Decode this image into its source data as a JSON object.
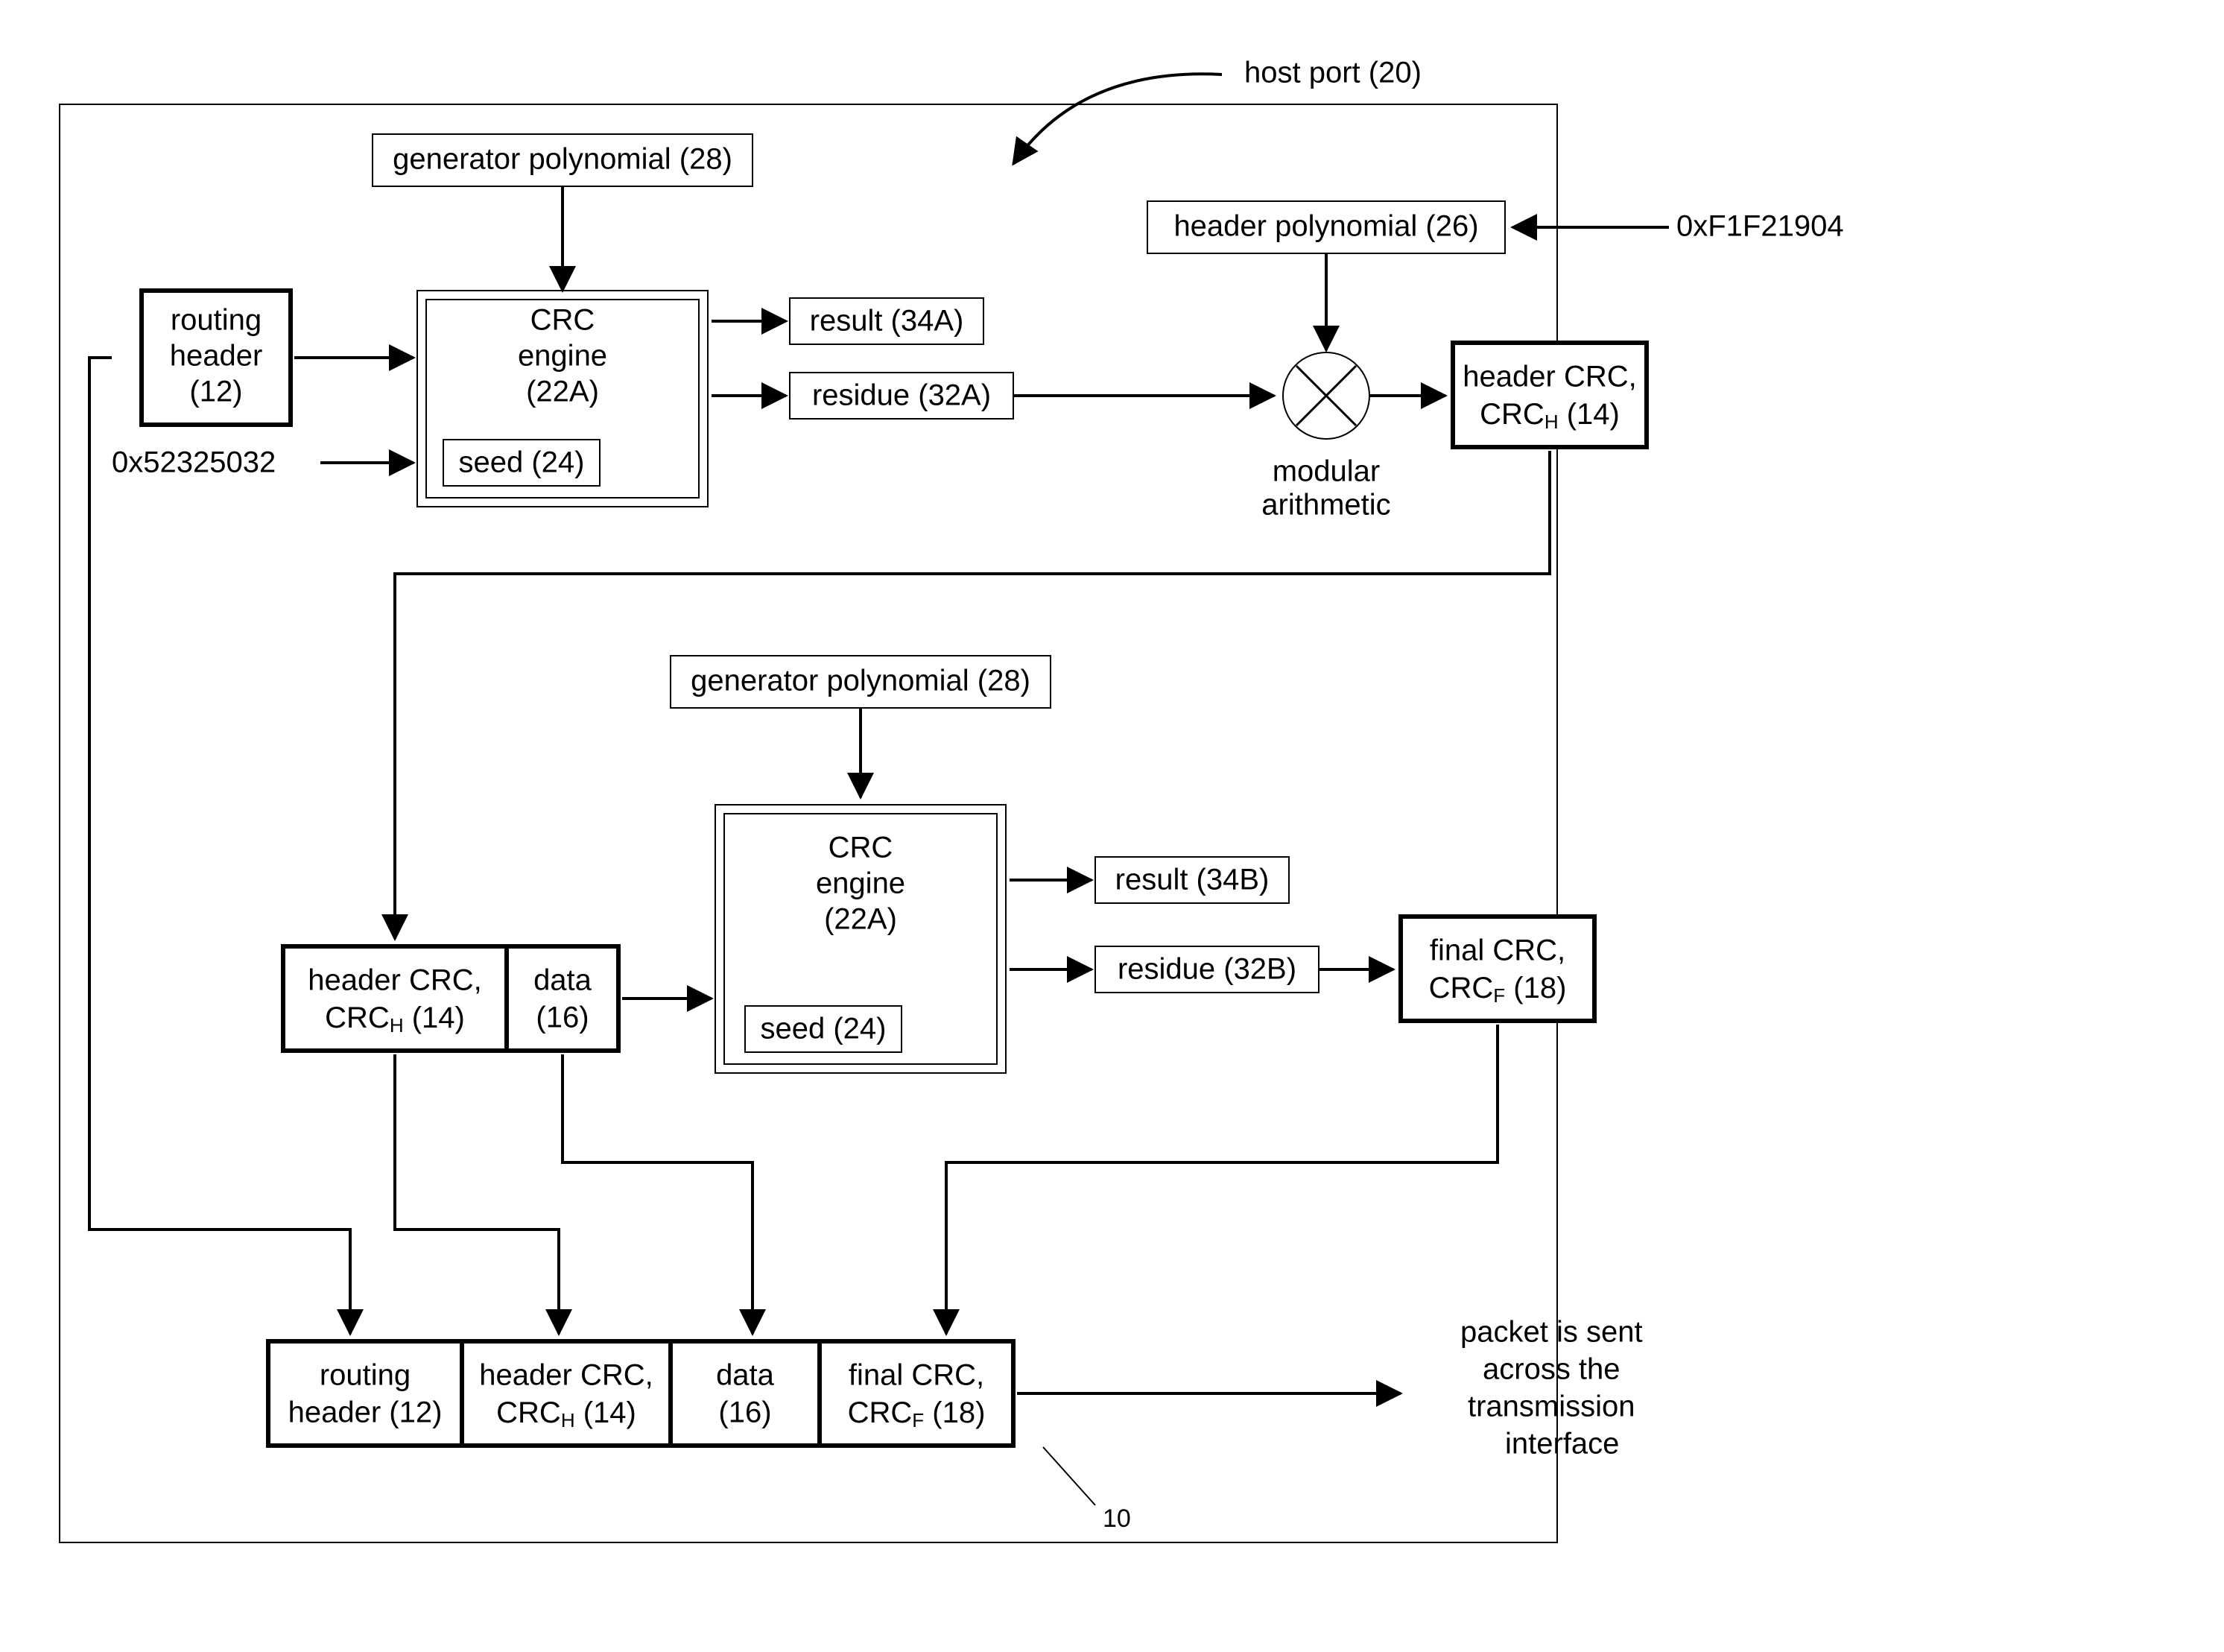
{
  "labels": {
    "host_port": "host port (20)",
    "gen_poly_1": "generator polynomial (28)",
    "gen_poly_2": "generator polynomial (28)",
    "header_poly": "header polynomial (26)",
    "hex_header_poly": "0xF1F21904",
    "routing_header_1": "routing",
    "routing_header_2": "header",
    "routing_header_3": "(12)",
    "crc_engine_1a": "CRC",
    "crc_engine_1b": "engine",
    "crc_engine_1c": "(22A)",
    "seed_1": "seed (24)",
    "seed_2": "seed (24)",
    "hex_seed": "0x52325032",
    "result_a": "result (34A)",
    "residue_a": "residue (32A)",
    "mod_arith_1": "modular",
    "mod_arith_2": "arithmetic",
    "hdr_crc_1a": "header CRC,",
    "hdr_crc_1b_pre": "CRC",
    "hdr_crc_1b_sub": "H",
    "hdr_crc_1b_post": " (14)",
    "hdr_crc_mid_a": "header CRC,",
    "hdr_crc_mid_b_pre": "CRC",
    "hdr_crc_mid_b_sub": "H",
    "hdr_crc_mid_b_post": " (14)",
    "data_mid_1": "data",
    "data_mid_2": "(16)",
    "crc_engine_2a": "CRC",
    "crc_engine_2b": "engine",
    "crc_engine_2c": "(22A)",
    "result_b": "result (34B)",
    "residue_b": "residue (32B)",
    "final_crc_1a": "final CRC,",
    "final_crc_1b_pre": "CRC",
    "final_crc_1b_sub": "F",
    "final_crc_1b_post": "  (18)",
    "pkt_routing_1": "routing",
    "pkt_routing_2": "header (12)",
    "pkt_hdrcrc_1": "header CRC,",
    "pkt_hdrcrc_2_pre": "CRC",
    "pkt_hdrcrc_2_sub": "H",
    "pkt_hdrcrc_2_post": " (14)",
    "pkt_data_1": "data",
    "pkt_data_2": "(16)",
    "pkt_final_1": "final CRC,",
    "pkt_final_2_pre": "CRC",
    "pkt_final_2_sub": "F",
    "pkt_final_2_post": " (18)",
    "ref_10": "10",
    "sent_1": "packet is sent",
    "sent_2": "across the",
    "sent_3": "transmission",
    "sent_4": "interface"
  }
}
